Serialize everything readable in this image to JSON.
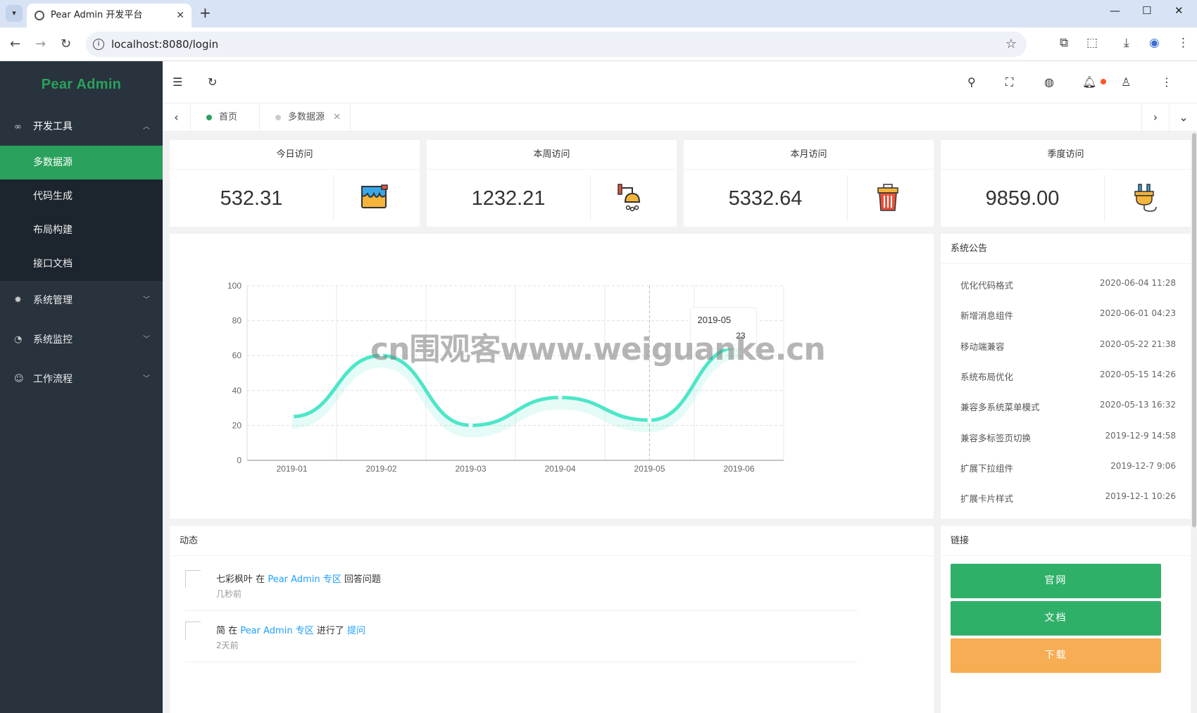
{
  "browser": {
    "tab_title": "Pear Admin 开发平台",
    "url": "localhost:8080/login"
  },
  "sidebar": {
    "logo": "Pear Admin",
    "dev_tools": "开发工具",
    "sub_items": [
      "多数据源",
      "代码生成",
      "布局构建",
      "接口文档"
    ],
    "groups": [
      "系统管理",
      "系统监控",
      "工作流程"
    ]
  },
  "tabs": [
    {
      "label": "首页",
      "dot_color": "#2aa15c"
    },
    {
      "label": "多数据源",
      "dot_color": "#ccc",
      "close": "✕"
    }
  ],
  "stats": [
    {
      "title": "今日访问",
      "value": "532.31"
    },
    {
      "title": "本周访问",
      "value": "1232.21"
    },
    {
      "title": "本月访问",
      "value": "5332.64"
    },
    {
      "title": "季度访问",
      "value": "9859.00"
    }
  ],
  "chart_data": {
    "type": "line",
    "categories": [
      "2019-01",
      "2019-02",
      "2019-03",
      "2019-04",
      "2019-05",
      "2019-06"
    ],
    "values": [
      25,
      60,
      20,
      36,
      23,
      65
    ],
    "ylim": [
      0,
      100
    ],
    "yticks": [
      "0",
      "20",
      "40",
      "60",
      "80",
      "100"
    ],
    "line_color": "#4ee6c8",
    "tooltip": {
      "date": "2019-05",
      "value": "23"
    }
  },
  "notice": {
    "title": "系统公告",
    "items": [
      {
        "text": "优化代码格式",
        "time": "2020-06-04 11:28"
      },
      {
        "text": "新增消息组件",
        "time": "2020-06-01 04:23"
      },
      {
        "text": "移动端兼容",
        "time": "2020-05-22 21:38"
      },
      {
        "text": "系统布局优化",
        "time": "2020-05-15 14:26"
      },
      {
        "text": "兼容多系统菜单模式",
        "time": "2020-05-13 16:32"
      },
      {
        "text": "兼容多标签页切换",
        "time": "2019-12-9 14:58"
      },
      {
        "text": "扩展下拉组件",
        "time": "2019-12-7 9:06"
      },
      {
        "text": "扩展卡片样式",
        "time": "2019-12-1 10:26"
      }
    ]
  },
  "activity": {
    "title": "动态",
    "items": [
      {
        "user": "七彩枫叶",
        "in": "在",
        "zone": "Pear Admin 专区",
        "action": "回答问题",
        "extra": "",
        "time": "几秒前"
      },
      {
        "user": "简",
        "in": "在",
        "zone": "Pear Admin 专区",
        "action": "进行了",
        "extra": "提问",
        "time": "2天前"
      }
    ]
  },
  "links": {
    "title": "链接",
    "buttons": [
      {
        "label": "官网",
        "color": "#2fb069"
      },
      {
        "label": "文档",
        "color": "#2fb069"
      },
      {
        "label": "下载",
        "color": "#f7ad54"
      }
    ]
  },
  "watermark": "cn围观客www.weiguanke.cn"
}
